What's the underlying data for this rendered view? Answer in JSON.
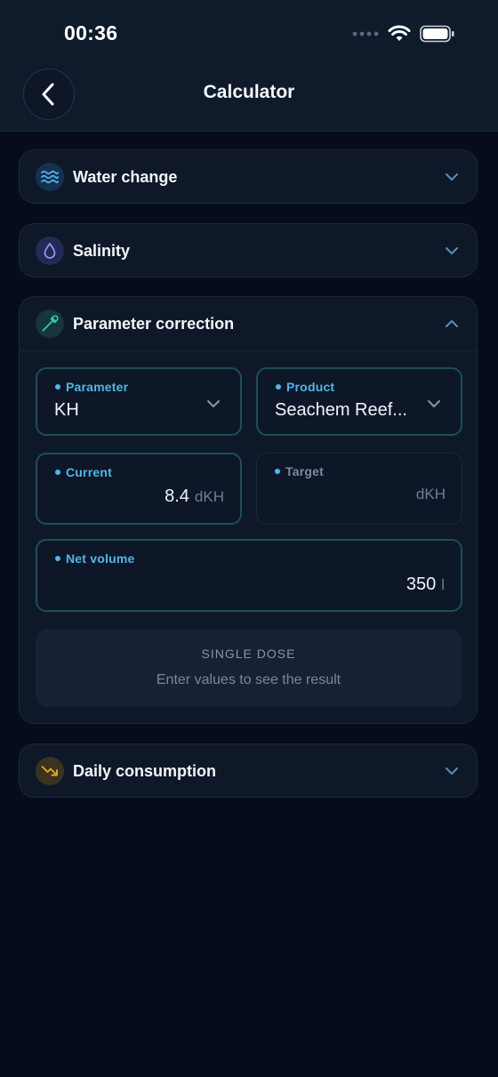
{
  "status": {
    "time": "00:36"
  },
  "header": {
    "title": "Calculator"
  },
  "sections": {
    "water_change": {
      "title": "Water change",
      "icon": "waves-icon"
    },
    "salinity": {
      "title": "Salinity",
      "icon": "droplet-icon"
    },
    "parameter_correction": {
      "title": "Parameter correction",
      "icon": "pipette-icon",
      "parameter": {
        "label": "Parameter",
        "value": "KH"
      },
      "product": {
        "label": "Product",
        "value": "Seachem Reef..."
      },
      "current": {
        "label": "Current",
        "value": "8.4",
        "unit": "dKH"
      },
      "target": {
        "label": "Target",
        "value": "",
        "unit": "dKH"
      },
      "net_volume": {
        "label": "Net volume",
        "value": "350",
        "unit": "l"
      },
      "result": {
        "title": "SINGLE DOSE",
        "hint": "Enter values to see the result"
      }
    },
    "daily_consumption": {
      "title": "Daily consumption",
      "icon": "trend-down-icon"
    }
  },
  "colors": {
    "background": "#060c1c",
    "card": "#0e1829",
    "accent": "#53b5e6",
    "active_border": "#1e4f55",
    "consumption_icon": "#e5a91a"
  }
}
